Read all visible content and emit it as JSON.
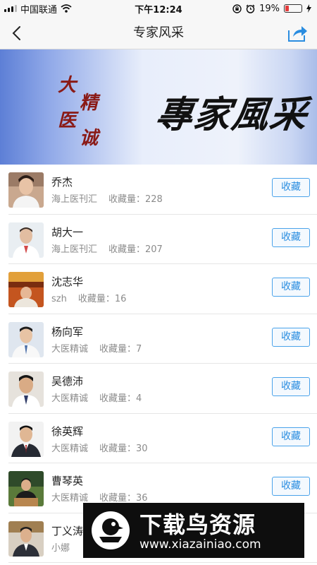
{
  "status_bar": {
    "carrier": "中国联通",
    "time": "下午12:24",
    "battery_percent": "19%",
    "battery_level": 0.19,
    "battery_color": "#e43b3b"
  },
  "nav": {
    "title": "专家风采",
    "back_icon": "chevron-left-icon",
    "share_icon": "share-icon"
  },
  "banner": {
    "calligraphy": [
      "大",
      "医",
      "精",
      "诚"
    ],
    "title": "專家風采"
  },
  "accent_color": "#2a8de0",
  "experts": [
    {
      "name": "乔杰",
      "source": "海上医刊汇",
      "fav_label": "收藏量：228",
      "button": "收藏"
    },
    {
      "name": "胡大一",
      "source": "海上医刊汇",
      "fav_label": "收藏量：207",
      "button": "收藏"
    },
    {
      "name": "沈志华",
      "source": "szh",
      "fav_label": "收藏量：16",
      "button": "收藏"
    },
    {
      "name": "杨向军",
      "source": "大医精诚",
      "fav_label": "收藏量：7",
      "button": "收藏"
    },
    {
      "name": "吴德沛",
      "source": "大医精诚",
      "fav_label": "收藏量：4",
      "button": "收藏"
    },
    {
      "name": "徐英辉",
      "source": "大医精诚",
      "fav_label": "收藏量：30",
      "button": "收藏"
    },
    {
      "name": "曹琴英",
      "source": "大医精诚",
      "fav_label": "收藏量：36",
      "button": "收藏"
    },
    {
      "name": "丁义涛",
      "source": "小娜",
      "fav_label": "",
      "button": ""
    }
  ],
  "watermark": {
    "title": "下载鸟资源",
    "url": "www.xiazainiao.com"
  }
}
